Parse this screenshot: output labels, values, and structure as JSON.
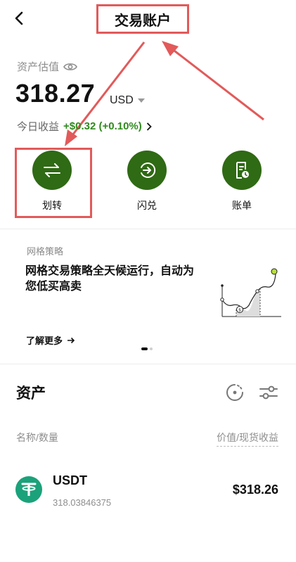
{
  "header": {
    "title": "交易账户"
  },
  "summary": {
    "label": "资产估值",
    "value": "318.27",
    "currency": "USD",
    "pnl_label": "今日收益",
    "pnl_value": "+$0.32 (+0.10%)"
  },
  "actions": [
    {
      "label": "划转",
      "icon": "transfer-arrows-icon"
    },
    {
      "label": "闪兑",
      "icon": "flash-convert-icon"
    },
    {
      "label": "账单",
      "icon": "bill-document-icon"
    }
  ],
  "promo": {
    "title": "网格策略",
    "text": "网格交易策略全天候运行，自动为您低买高卖",
    "link": "了解更多",
    "carousel_pages": 2,
    "carousel_active": 1
  },
  "assets": {
    "title": "资产",
    "col_left": "名称/数量",
    "col_right": "价值/现货收益",
    "items": [
      {
        "name": "USDT",
        "amount": "318.03846375",
        "value": "$318.26"
      }
    ]
  },
  "colors": {
    "brand_green": "#2f6a14",
    "profit_green": "#2f8a1e",
    "annotation_red": "#e25a5a",
    "usdt_teal": "#1ba27a"
  }
}
